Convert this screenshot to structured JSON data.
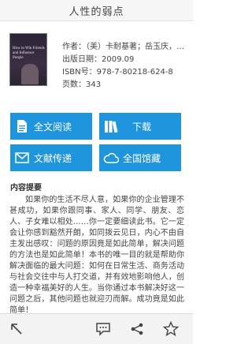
{
  "header": {
    "title": "人性的弱点"
  },
  "book": {
    "cover_text": "How to Win Friends and Influence People",
    "author": "作者：（美）卡耐基著；岳玉庆，…",
    "date": "出版日期：2009.09",
    "isbn": "ISBN号：978-7-80218-624-8",
    "pages": "页数：343"
  },
  "actions": {
    "read": "全文阅读",
    "download": "下载",
    "doc_delivery": "文献传递",
    "library": "全国馆藏"
  },
  "summary": {
    "title": "内容提要",
    "text": "如果你的生活不尽人意，如果你的企业管理不甚成功，如果你跟同事、家人、同学、朋友、恋人、子女难以相处……你一定要细读此书。它一定会让你感到豁然开朗，如同拨云见日，内心不由自主发出感叹：问题的原因竟是如此简单，解决问题的方法也是如此简单！本书的唯一目的就是帮助你解决面临的最大问题：如何在日常生活、商务活动与社会交往中与人打交道，并有效地影响他人，创造一种幸福美好的人生。当你通过本书解决好这一问题之后，其他问题也就迎刃而解。成功竟是如此简单！"
  },
  "colors": {
    "accent": "#1f95dd"
  },
  "bottom_icons": [
    "back-arrow-icon",
    "comment-icon",
    "share-icon",
    "favorite-star-icon"
  ]
}
